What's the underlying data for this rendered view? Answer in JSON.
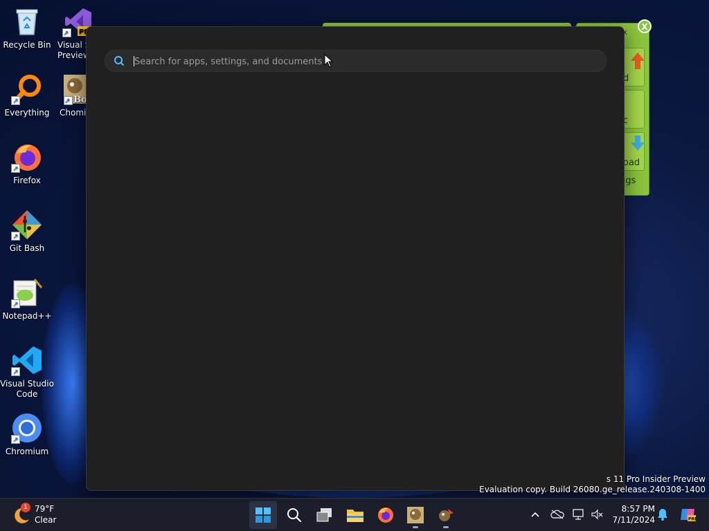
{
  "desktop": {
    "icons": [
      {
        "label": "Recycle Bin"
      },
      {
        "label": "Visual Studio 2022 Preview"
      },
      {
        "label": "Everything"
      },
      {
        "label": "Chomikbox"
      },
      {
        "label": "Firefox"
      },
      {
        "label": "Git Bash"
      },
      {
        "label": "Notepad++"
      },
      {
        "label": "Visual Studio Code"
      },
      {
        "label": "Chromium"
      }
    ],
    "widget": {
      "close_label": "X",
      "partial_texts": [
        "ox",
        "d",
        "c",
        "oad",
        "ngs"
      ]
    },
    "watermark": {
      "line1": "s 11 Pro Insider Preview",
      "line2": "Evaluation copy. Build 26080.ge_release.240308-1400"
    }
  },
  "search_panel": {
    "placeholder": "Search for apps, settings, and documents",
    "value": ""
  },
  "taskbar": {
    "weather": {
      "badge": "1",
      "temperature": "79°F",
      "condition": "Clear"
    },
    "apps": [
      "start-icon",
      "search-icon",
      "task-view-icon",
      "file-explorer-icon",
      "firefox-icon",
      "chomikbox-icon",
      "app-icon"
    ],
    "clock": {
      "time": "8:57 PM",
      "date": "7/11/2024"
    }
  },
  "colors": {
    "panel_bg": "#202020",
    "widget_green": "#8cc63f",
    "taskbar_bg": "#1c1f2b",
    "accent": "#4cc2ff"
  }
}
